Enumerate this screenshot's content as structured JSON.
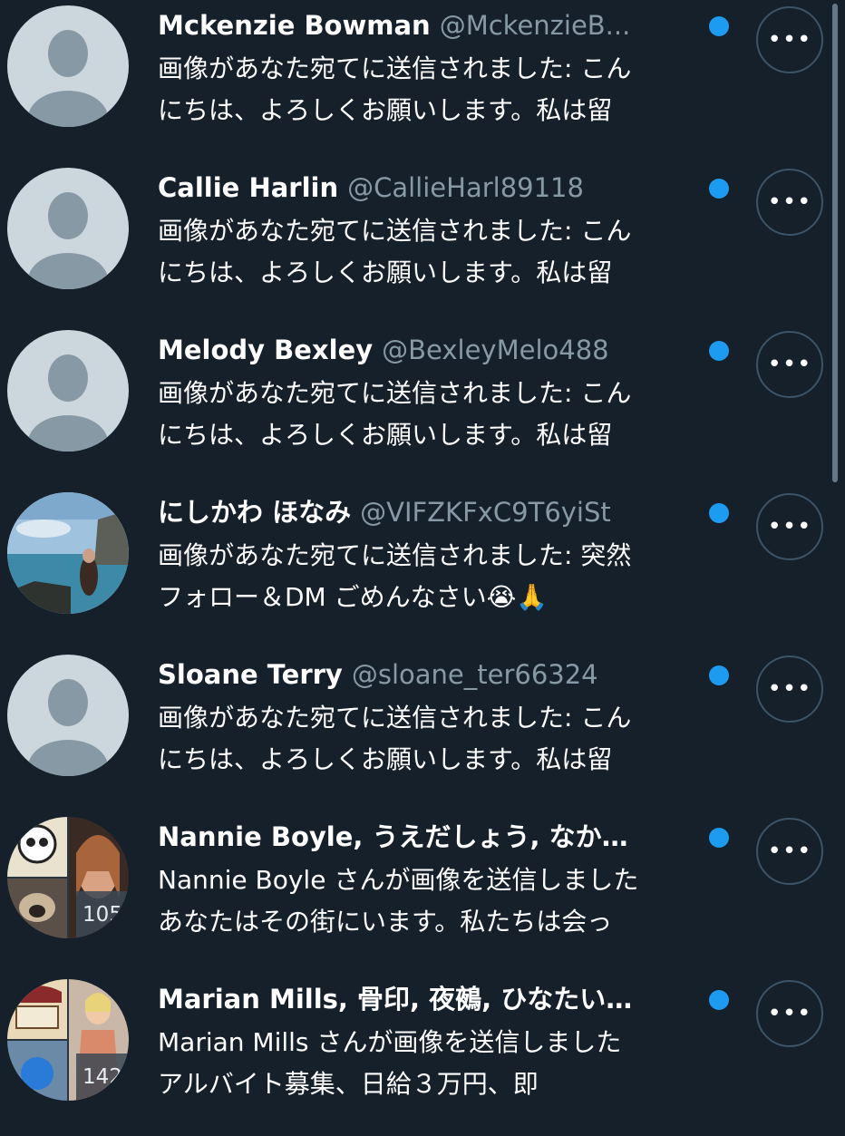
{
  "conversations": [
    {
      "avatar": "default-avatar",
      "name": "Mckenzie Bowman",
      "handle": "@MckenzieB...",
      "line1": "画像があなた宛てに送信されました: こん",
      "line2": "にちは、よろしくお願いします。私は留",
      "unread": true
    },
    {
      "avatar": "default-avatar",
      "name": "Callie Harlin",
      "handle": "@CallieHarl89118",
      "line1": "画像があなた宛てに送信されました: こん",
      "line2": "にちは、よろしくお願いします。私は留",
      "unread": true
    },
    {
      "avatar": "default-avatar",
      "name": "Melody Bexley",
      "handle": "@BexleyMelo488",
      "line1": "画像があなた宛てに送信されました: こん",
      "line2": "にちは、よろしくお願いします。私は留",
      "unread": true
    },
    {
      "avatar": "photo-avatar-seaside",
      "name": "にしかわ ほなみ",
      "handle": "@VIFZKFxC9T6yiSt",
      "line1": "画像があなた宛てに送信されました: 突然",
      "line2": "フォロー＆DM ごめんなさい😭🙏",
      "unread": true
    },
    {
      "avatar": "default-avatar",
      "name": "Sloane Terry",
      "handle": "@sloane_ter66324",
      "line1": "画像があなた宛てに送信されました: こん",
      "line2": "にちは、よろしくお願いします。私は留",
      "unread": true
    },
    {
      "avatar": "group-avatar",
      "member_count": "105",
      "name": "Nannie Boyle, うえだしょう, なか…",
      "handle": "",
      "line1": "Nannie Boyle さんが画像を送信しました",
      "line2": "あなたはその街にいます。私たちは会っ",
      "unread": true
    },
    {
      "avatar": "group-avatar",
      "member_count": "142",
      "name": "Marian Mills, 骨印, 夜鵺, ひなたい…",
      "handle": "",
      "line1": "Marian Mills さんが画像を送信しました",
      "line2": "アルバイト募集、日給３万円、即",
      "unread": true
    }
  ],
  "more_button_label": "•••",
  "colors": {
    "background": "#15202b",
    "unread_dot": "#1d9bf0",
    "handle_text": "#8899a6"
  }
}
